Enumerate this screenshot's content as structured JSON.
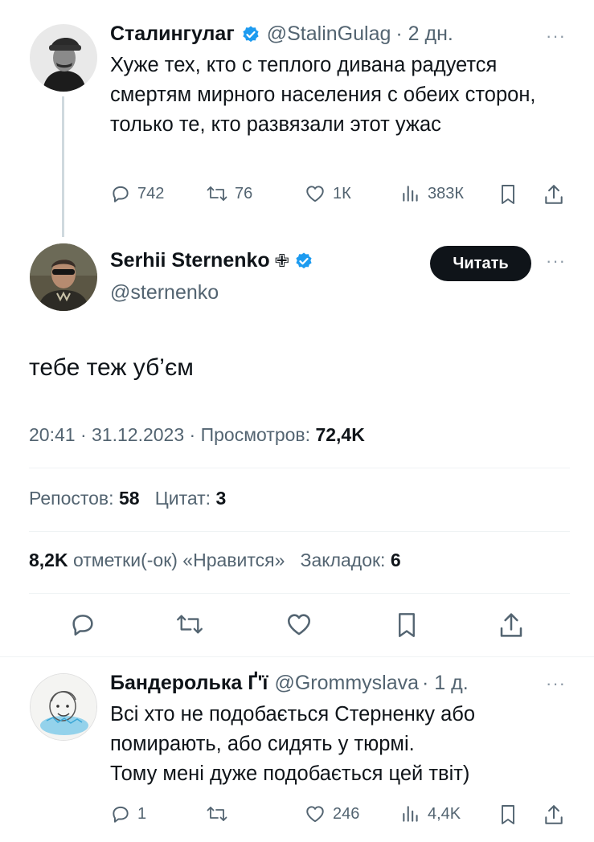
{
  "parent_tweet": {
    "name": "Сталингулаг",
    "handle": "@StalinGulag",
    "time": "· 2 дн.",
    "text": "Хуже тех, кто с теплого дивана радуется смертям мирного населения с обеих сторон, только те, кто развязали этот ужас",
    "replies": "742",
    "retweets": "76",
    "likes": "1К",
    "views": "383К"
  },
  "main_tweet": {
    "name": "Serhii Sternenko",
    "name_badge": "✙",
    "handle": "@sternenko",
    "follow_label": "Читать",
    "text": "тебе теж уб’єм",
    "time": "20:41",
    "date": "31.12.2023",
    "views_label": "Просмотров:",
    "views": "72,4K",
    "reposts_label": "Репостов:",
    "reposts": "58",
    "quotes_label": "Цитат:",
    "quotes": "3",
    "likes": "8,2K",
    "likes_label": "отметки(-ок) «Нравится»",
    "bookmarks_label": "Закладок:",
    "bookmarks": "6"
  },
  "reply_tweet": {
    "name": "Бандеролька Ґ'ї",
    "handle": "@Grommyslava",
    "time": "· 1 д.",
    "text_lines": [
      "Всі хто не подобається Стерненку або",
      "помирають, або сидять у тюрмі.",
      "Тому мені дуже подобається цей твіт)"
    ],
    "replies": "1",
    "retweets": "",
    "likes": "246",
    "views": "4,4K"
  },
  "colors": {
    "text": "#0f1419",
    "muted": "#536471",
    "verified": "#1d9bf0",
    "divider": "#eff3f4",
    "button": "#0f1419"
  },
  "icons": [
    "reply-icon",
    "retweet-icon",
    "like-icon",
    "views-icon",
    "bookmark-icon",
    "share-icon",
    "verified-icon",
    "more-icon"
  ]
}
